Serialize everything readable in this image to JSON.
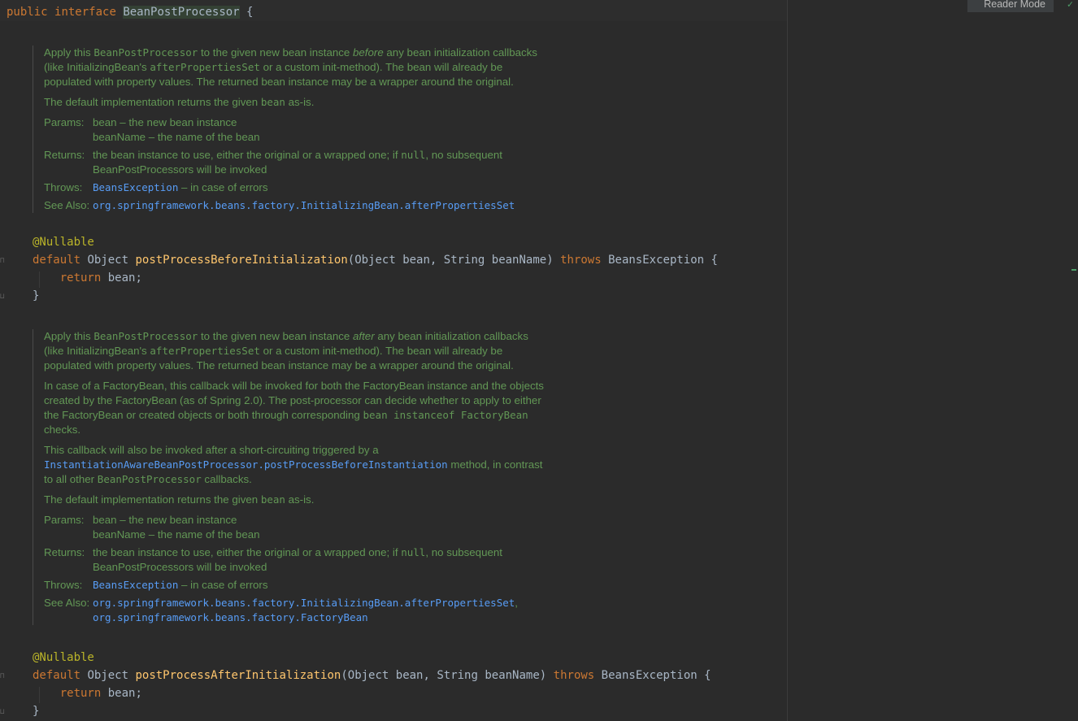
{
  "header": {
    "kw_public": "public",
    "kw_interface": "interface",
    "name": "BeanPostProcessor",
    "brace": "{",
    "reader_mode": "Reader Mode"
  },
  "doc1": {
    "p1_a": "Apply this ",
    "p1_code": "BeanPostProcessor",
    "p1_b": " to the given new bean instance ",
    "p1_em": "before",
    "p1_c": " any bean initialization callbacks (like InitializingBean's ",
    "p1_code2": "afterPropertiesSet",
    "p1_d": " or a custom init-method). The bean will already be populated with property values. The returned bean instance may be a wrapper around the original.",
    "p2_a": "The default implementation returns the given ",
    "p2_code": "bean",
    "p2_b": " as-is.",
    "params_k": "Params:",
    "params_v1": "bean – the new bean instance",
    "params_v2": "beanName – the name of the bean",
    "returns_k": "Returns:",
    "returns_a": "the bean instance to use, either the original or a wrapped one; if ",
    "returns_code": "null",
    "returns_b": ", no subsequent BeanPostProcessors will be invoked",
    "throws_k": "Throws:",
    "throws_link": "BeansException",
    "throws_b": " – in case of errors",
    "see_k": "See Also:",
    "see_1": "org.springframework.beans.factory.InitializingBean.afterPropertiesSet"
  },
  "method1": {
    "annotation": "@Nullable",
    "kw_default": "default",
    "ret_type": "Object",
    "name": "postProcessBeforeInitialization",
    "params": "(Object bean, String beanName)",
    "kw_throws": "throws",
    "exc": "BeansException {",
    "kw_return": "return",
    "ret_val": "bean;",
    "close": "}"
  },
  "doc2": {
    "p1_a": "Apply this ",
    "p1_code": "BeanPostProcessor",
    "p1_b": " to the given new bean instance ",
    "p1_em": "after",
    "p1_c": " any bean initialization callbacks (like InitializingBean's ",
    "p1_code2": "afterPropertiesSet",
    "p1_d": " or a custom init-method). The bean will already be populated with property values. The returned bean instance may be a wrapper around the original.",
    "p2_a": "In case of a FactoryBean, this callback will be invoked for both the FactoryBean instance and the objects created by the FactoryBean (as of Spring 2.0). The post-processor can decide whether to apply to either the FactoryBean or created objects or both through corresponding ",
    "p2_code": "bean instanceof FactoryBean",
    "p2_b": " checks.",
    "p3_a": "This callback will also be invoked after a short-circuiting triggered by a ",
    "p3_link": "InstantiationAwareBeanPostProcessor.postProcessBeforeInstantiation",
    "p3_b": " method, in contrast to all other ",
    "p3_code": "BeanPostProcessor",
    "p3_c": " callbacks.",
    "p4_a": "The default implementation returns the given ",
    "p4_code": "bean",
    "p4_b": " as-is.",
    "params_k": "Params:",
    "params_v1": "bean – the new bean instance",
    "params_v2": "beanName – the name of the bean",
    "returns_k": "Returns:",
    "returns_a": "the bean instance to use, either the original or a wrapped one; if ",
    "returns_code": "null",
    "returns_b": ", no subsequent BeanPostProcessors will be invoked",
    "throws_k": "Throws:",
    "throws_link": "BeansException",
    "throws_b": " – in case of errors",
    "see_k": "See Also:",
    "see_1": "org.springframework.beans.factory.InitializingBean.afterPropertiesSet",
    "see_sep": ",",
    "see_2": "org.springframework.beans.factory.FactoryBean"
  },
  "method2": {
    "annotation": "@Nullable",
    "kw_default": "default",
    "ret_type": "Object",
    "name": "postProcessAfterInitialization",
    "params": "(Object bean, String beanName)",
    "kw_throws": "throws",
    "exc": "BeansException {",
    "kw_return": "return",
    "ret_val": "bean;",
    "close": "}"
  }
}
